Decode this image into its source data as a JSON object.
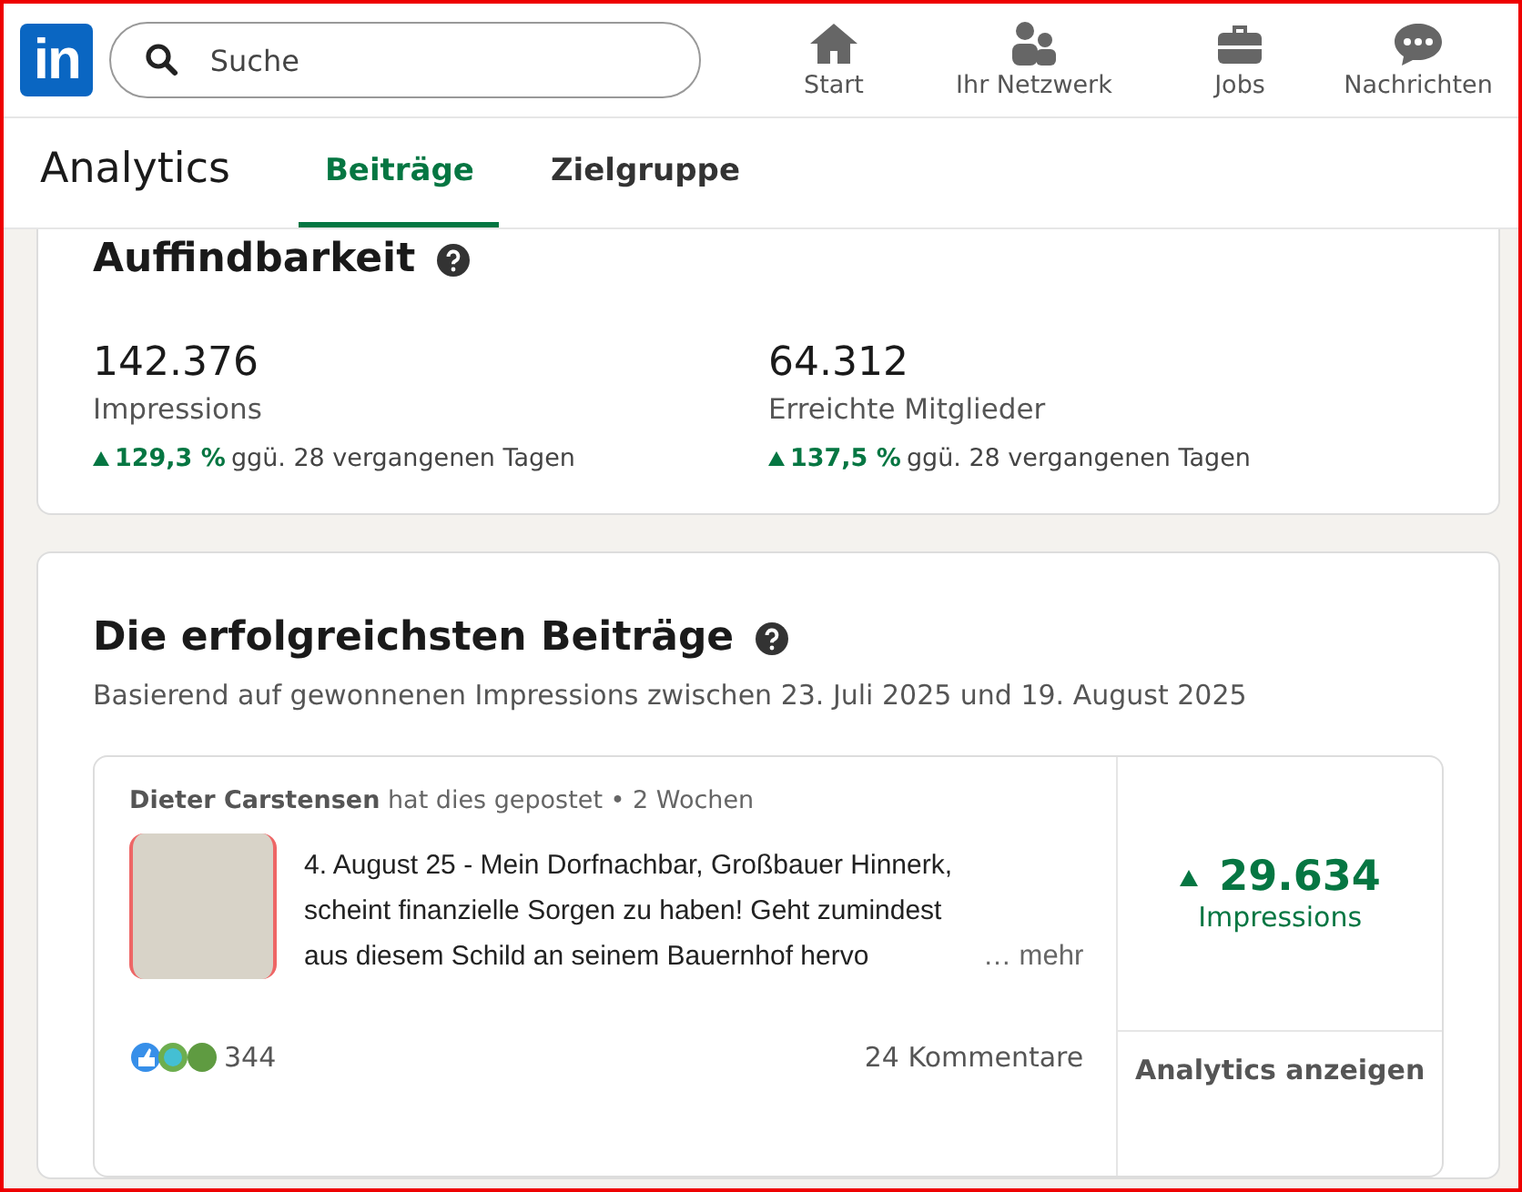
{
  "header": {
    "logo": "in",
    "search": {
      "placeholder": "Suche"
    },
    "nav": [
      {
        "label": "Start"
      },
      {
        "label": "Ihr Netzwerk"
      },
      {
        "label": "Jobs"
      },
      {
        "label": "Nachrichten"
      }
    ]
  },
  "analytics_bar": {
    "title": "Analytics",
    "tabs": [
      {
        "label": "Beiträge",
        "selected": true
      },
      {
        "label": "Zielgruppe",
        "selected": false
      }
    ]
  },
  "discoverability": {
    "title": "Auffindbarkeit",
    "metrics": [
      {
        "value": "142.376",
        "label": "Impressions",
        "change": "129,3 %",
        "comparison": "ggü. 28 vergangenen Tagen"
      },
      {
        "value": "64.312",
        "label": "Erreichte Mitglieder",
        "change": "137,5 %",
        "comparison": "ggü. 28 vergangenen Tagen"
      }
    ]
  },
  "top_posts": {
    "title": "Die erfolgreichsten Beiträge",
    "subtitle": "Basierend auf gewonnenen Impressions zwischen 23. Juli 2025 und 19. August 2025",
    "posts": [
      {
        "author": "Dieter Carstensen",
        "action": "hat dies gepostet",
        "age": "• 2 Wochen",
        "text": "4. August 25 - Mein Dorfnachbar, Großbauer Hinnerk, scheint finanzielle Sorgen zu haben! Geht zumindest aus diesem Schild an seinem Bauernhof hervo",
        "more": "… mehr",
        "reactions": "344",
        "comments": "24 Kommentare",
        "impressions": "29.634",
        "impressions_label": "Impressions",
        "analytics_link": "Analytics anzeigen"
      }
    ]
  }
}
